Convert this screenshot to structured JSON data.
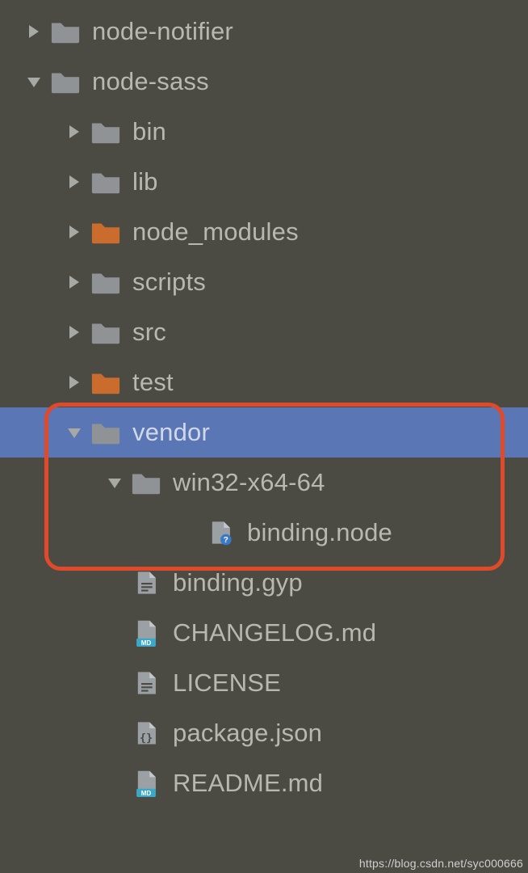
{
  "tree": [
    {
      "indent": 0,
      "arrow": "right",
      "icon": "folder-gray",
      "label": "node-notifier",
      "selected": false
    },
    {
      "indent": 0,
      "arrow": "down",
      "icon": "folder-gray",
      "label": "node-sass",
      "selected": false
    },
    {
      "indent": 1,
      "arrow": "right",
      "icon": "folder-gray",
      "label": "bin",
      "selected": false
    },
    {
      "indent": 1,
      "arrow": "right",
      "icon": "folder-gray",
      "label": "lib",
      "selected": false
    },
    {
      "indent": 1,
      "arrow": "right",
      "icon": "folder-orange",
      "label": "node_modules",
      "selected": false
    },
    {
      "indent": 1,
      "arrow": "right",
      "icon": "folder-gray",
      "label": "scripts",
      "selected": false
    },
    {
      "indent": 1,
      "arrow": "right",
      "icon": "folder-gray",
      "label": "src",
      "selected": false
    },
    {
      "indent": 1,
      "arrow": "right",
      "icon": "folder-orange",
      "label": "test",
      "selected": false
    },
    {
      "indent": 1,
      "arrow": "down",
      "icon": "folder-gray",
      "label": "vendor",
      "selected": true
    },
    {
      "indent": 2,
      "arrow": "down",
      "icon": "folder-gray",
      "label": "win32-x64-64",
      "selected": false
    },
    {
      "indent": 3,
      "arrow": "none",
      "icon": "file-unknown",
      "label": "binding.node",
      "selected": false
    },
    {
      "indent": 2,
      "arrow": "none",
      "icon": "file-text",
      "label": "binding.gyp",
      "selected": false
    },
    {
      "indent": 2,
      "arrow": "none",
      "icon": "file-md",
      "label": "CHANGELOG.md",
      "selected": false
    },
    {
      "indent": 2,
      "arrow": "none",
      "icon": "file-text",
      "label": "LICENSE",
      "selected": false
    },
    {
      "indent": 2,
      "arrow": "none",
      "icon": "file-json",
      "label": "package.json",
      "selected": false
    },
    {
      "indent": 2,
      "arrow": "none",
      "icon": "file-md",
      "label": "README.md",
      "selected": false
    }
  ],
  "colors": {
    "folder_gray": "#8f9396",
    "folder_orange": "#c96c2d",
    "arrow": "#a7a9a5",
    "file_gray": "#9aa0a4",
    "md_badge": "#3aa9c9"
  },
  "watermark": "https://blog.csdn.net/syc000666"
}
